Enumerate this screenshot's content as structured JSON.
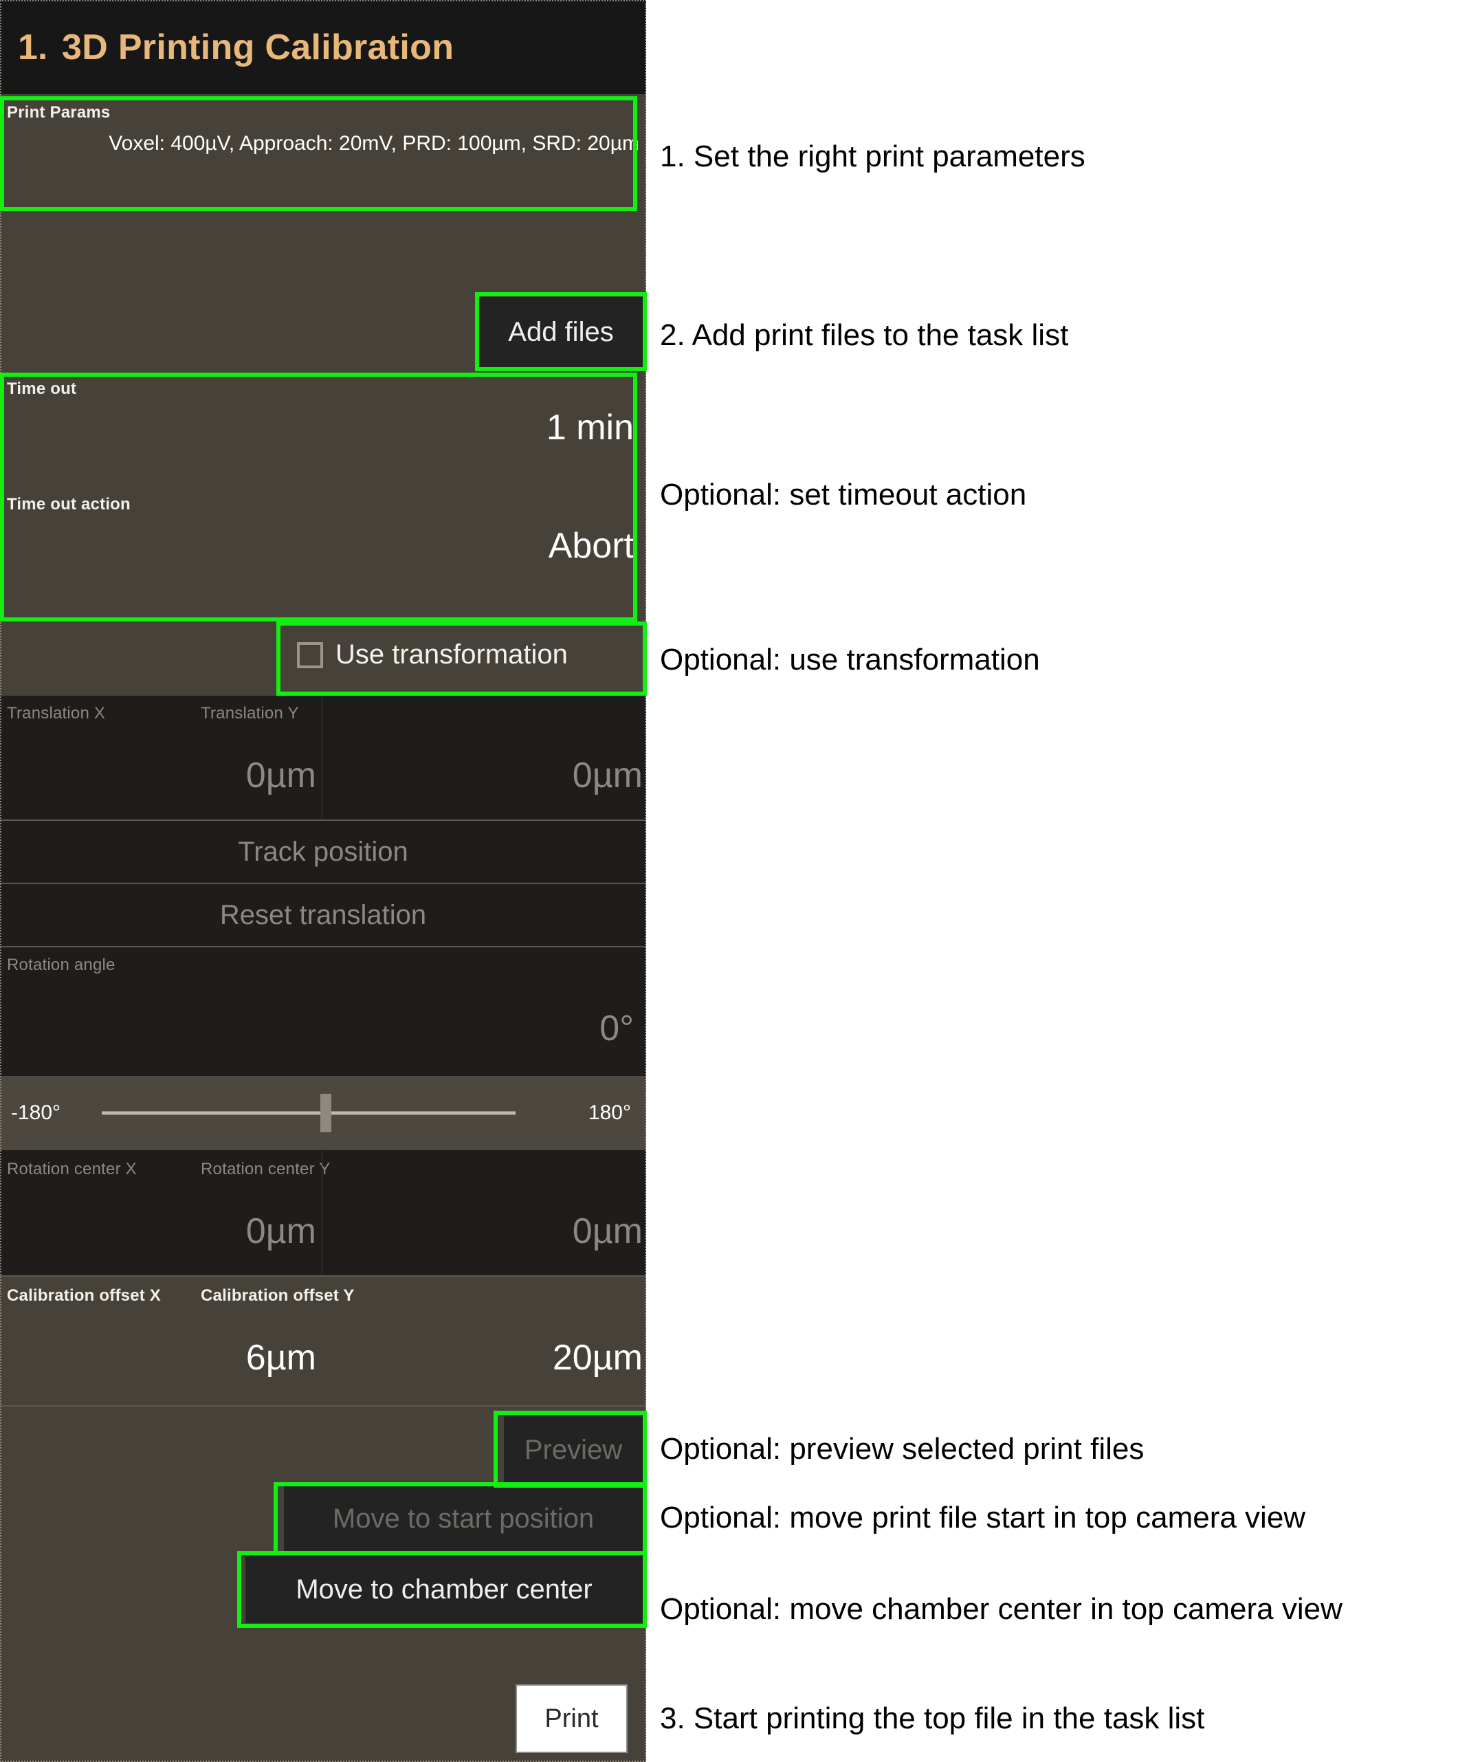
{
  "header": {
    "step_number": "1.",
    "title": "3D Printing Calibration"
  },
  "print_params": {
    "label": "Print Params",
    "value": "Voxel: 400µV, Approach: 20mV, PRD: 100µm, SRD: 20µm"
  },
  "task_list": {
    "add_files_label": "Add files"
  },
  "timeout": {
    "label": "Time out",
    "value": "1 min",
    "action_label": "Time out action",
    "action_value": "Abort"
  },
  "transformation": {
    "checkbox_label": "Use transformation",
    "checked": false
  },
  "translation": {
    "x_label": "Translation X",
    "x_value": "0µm",
    "y_label": "Translation Y",
    "y_value": "0µm",
    "track_position_label": "Track position",
    "reset_translation_label": "Reset translation"
  },
  "rotation": {
    "angle_label": "Rotation angle",
    "angle_value": "0°",
    "slider_min_label": "-180°",
    "slider_max_label": "180°",
    "slider_value": 0,
    "center_x_label": "Rotation center X",
    "center_x_value": "0µm",
    "center_y_label": "Rotation center Y",
    "center_y_value": "0µm"
  },
  "calibration": {
    "offset_x_label": "Calibration offset X",
    "offset_x_value": "6µm",
    "offset_y_label": "Calibration offset Y",
    "offset_y_value": "20µm"
  },
  "actions": {
    "preview_label": "Preview",
    "move_to_start_label": "Move to start position",
    "move_to_chamber_label": "Move to chamber center",
    "print_label": "Print"
  },
  "annotations": [
    "1. Set the right print parameters",
    "2. Add print files to the task list",
    "Optional: set timeout action",
    "Optional: use transformation",
    "Optional: preview selected print files",
    "Optional: move print file start in top camera view",
    "Optional: move chamber center in top camera view",
    "3. Start printing the top file in the task list"
  ],
  "colors": {
    "highlight": "#12f012",
    "title": "#e8b87a",
    "panel_enabled_bg": "#474239",
    "panel_disabled_bg": "#1e1d1b",
    "button_bg": "#232323"
  }
}
